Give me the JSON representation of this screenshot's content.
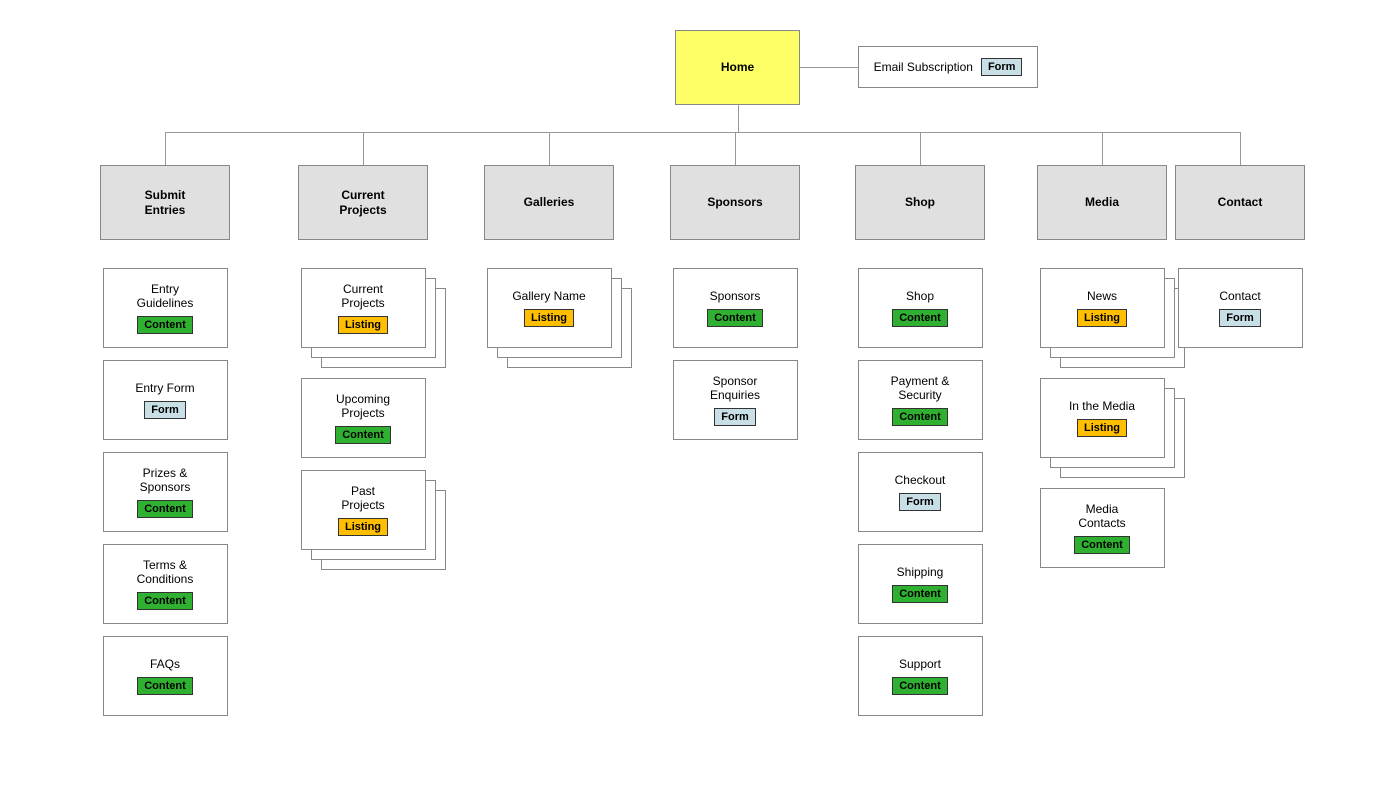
{
  "root": {
    "label": "Home"
  },
  "side": {
    "label": "Email Subscription",
    "tag": "Form"
  },
  "sections": [
    {
      "label": "Submit\nEntries",
      "children": [
        {
          "label": "Entry\nGuidelines",
          "tag": "Content"
        },
        {
          "label": "Entry Form",
          "tag": "Form"
        },
        {
          "label": "Prizes &\nSponsors",
          "tag": "Content"
        },
        {
          "label": "Terms &\nConditions",
          "tag": "Content"
        },
        {
          "label": "FAQs",
          "tag": "Content"
        }
      ]
    },
    {
      "label": "Current\nProjects",
      "children": [
        {
          "label": "Current\nProjects",
          "tag": "Listing",
          "stacked": true
        },
        {
          "label": "Upcoming\nProjects",
          "tag": "Content"
        },
        {
          "label": "Past\nProjects",
          "tag": "Listing",
          "stacked": true
        }
      ]
    },
    {
      "label": "Galleries",
      "children": [
        {
          "label": "Gallery Name",
          "tag": "Listing",
          "stacked": true
        }
      ]
    },
    {
      "label": "Sponsors",
      "children": [
        {
          "label": "Sponsors",
          "tag": "Content"
        },
        {
          "label": "Sponsor\nEnquiries",
          "tag": "Form"
        }
      ]
    },
    {
      "label": "Shop",
      "children": [
        {
          "label": "Shop",
          "tag": "Content"
        },
        {
          "label": "Payment &\nSecurity",
          "tag": "Content"
        },
        {
          "label": "Checkout",
          "tag": "Form"
        },
        {
          "label": "Shipping",
          "tag": "Content"
        },
        {
          "label": "Support",
          "tag": "Content"
        }
      ]
    },
    {
      "label": "Media",
      "children": [
        {
          "label": "News",
          "tag": "Listing",
          "stacked": true
        },
        {
          "label": "In the Media",
          "tag": "Listing",
          "stacked": true
        },
        {
          "label": "Media\nContacts",
          "tag": "Content"
        }
      ]
    },
    {
      "label": "Contact",
      "children": [
        {
          "label": "Contact",
          "tag": "Form"
        }
      ]
    }
  ],
  "tag_labels": {
    "Content": "Content",
    "Listing": "Listing",
    "Form": "Form"
  },
  "colors": {
    "root_bg": "#feff66",
    "section_bg": "#e0e0e0",
    "content": "#30b030",
    "listing": "#ffbf00",
    "form": "#c8dfe6",
    "line": "#999"
  }
}
